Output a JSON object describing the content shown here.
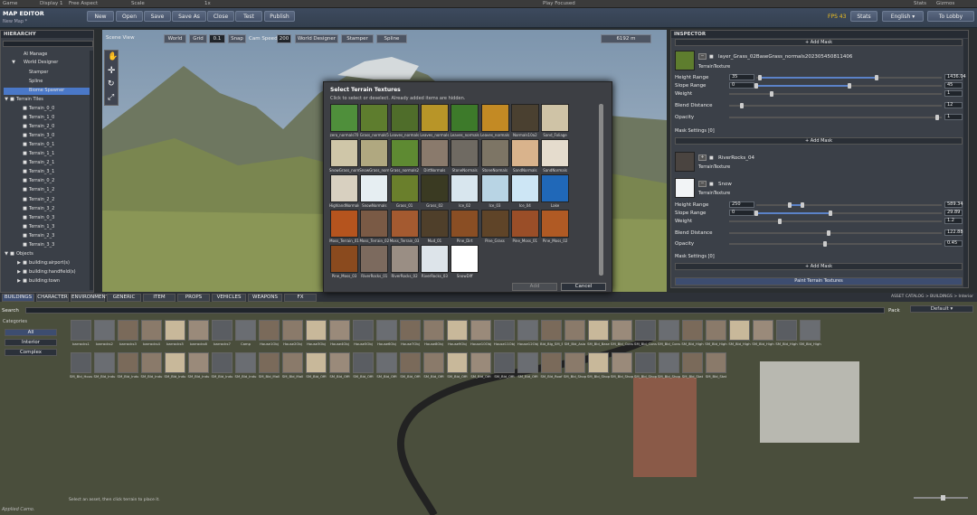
{
  "unity": {
    "game": "Game",
    "display": "Display 1",
    "aspect": "Free Aspect",
    "scale_label": "Scale",
    "scale_val": "1x",
    "play_focused": "Play Focused",
    "stats": "Stats",
    "gizmos": "Gizmos"
  },
  "topbar": {
    "title": "MAP EDITOR",
    "subtitle": "New Map *",
    "buttons": [
      "New",
      "Open",
      "Save",
      "Save As",
      "Close",
      "Test",
      "Publish"
    ],
    "fps": "FPS 43",
    "stats": "Stats",
    "language": "English",
    "to_lobby": "To Lobby"
  },
  "hierarchy": {
    "title": "HIERARCHY",
    "items": [
      "AI Manage",
      "World Designer",
      "Stamper",
      "Spline",
      "Biome Spawner",
      "Terrain Tiles",
      "Terrain_0_0",
      "Terrain_1_0",
      "Terrain_2_0",
      "Terrain_3_0",
      "Terrain_0_1",
      "Terrain_1_1",
      "Terrain_2_1",
      "Terrain_3_1",
      "Terrain_0_2",
      "Terrain_1_2",
      "Terrain_2_2",
      "Terrain_3_2",
      "Terrain_0_3",
      "Terrain_1_3",
      "Terrain_2_3",
      "Terrain_3_3",
      "Objects",
      "building:airport(s)",
      "building:handfield(s)",
      "building:town"
    ]
  },
  "scene": {
    "label": "Scene View",
    "buttons": [
      "World",
      "Grid",
      "0.1",
      "Snap"
    ],
    "cam_speed_label": "Cam Speed",
    "cam_speed": "200",
    "designer_buttons": [
      "World Designer",
      "Stamper",
      "Spline"
    ],
    "distance": "6192 m"
  },
  "dialog": {
    "title": "Select Terrain Textures",
    "subtitle": "Click to select or deselect. Already added items are hidden.",
    "add": "Add",
    "cancel": "Cancel",
    "tiles": [
      {
        "label": "zero_normals70",
        "color": "#4f8f3b"
      },
      {
        "label": "Grass_normals5",
        "color": "#5e7d2e"
      },
      {
        "label": "Leaves_normals",
        "color": "#4f6d2a"
      },
      {
        "label": "Leaves_normals",
        "color": "#b89528"
      },
      {
        "label": "Leaves_normals",
        "color": "#3d7a2a"
      },
      {
        "label": "Leaves_normals",
        "color": "#c38a24"
      },
      {
        "label": "Normals10a2",
        "color": "#4a4030"
      },
      {
        "label": "Sand_Foliage",
        "color": "#cfc3a6"
      },
      {
        "label": "SnowGrass_norm",
        "color": "#cfc6a8"
      },
      {
        "label": "SnowGrass_norm",
        "color": "#b0a880"
      },
      {
        "label": "Grass_normals2",
        "color": "#5e8a32"
      },
      {
        "label": "DirtNormals",
        "color": "#8a7a6c"
      },
      {
        "label": "StoneNormals",
        "color": "#6f6a62"
      },
      {
        "label": "StoneNormals",
        "color": "#7d7565"
      },
      {
        "label": "SandNormals",
        "color": "#d9b38c"
      },
      {
        "label": "SandNormals",
        "color": "#e5dccd"
      },
      {
        "label": "HighlandNormals",
        "color": "#d8d0c0"
      },
      {
        "label": "SnowNormals",
        "color": "#e6eef2"
      },
      {
        "label": "Grass_01",
        "color": "#6a7f2c"
      },
      {
        "label": "Grass_02",
        "color": "#3a3a22"
      },
      {
        "label": "Ice_02",
        "color": "#d8e6ee"
      },
      {
        "label": "Ice_03",
        "color": "#b8d4e4"
      },
      {
        "label": "Ice_04",
        "color": "#cde6f5"
      },
      {
        "label": "Lake",
        "color": "#2068b8"
      },
      {
        "label": "Moss_Terrain_01",
        "color": "#b5541e"
      },
      {
        "label": "Moss_Terrain_02",
        "color": "#7a5a45"
      },
      {
        "label": "Moss_Terrain_03",
        "color": "#a45a30"
      },
      {
        "label": "Mud_01",
        "color": "#4f3f2a"
      },
      {
        "label": "Pine_Dirt",
        "color": "#8a4e24"
      },
      {
        "label": "Pine_Grass",
        "color": "#5f4428"
      },
      {
        "label": "Pine_Moss_01",
        "color": "#9a4e28"
      },
      {
        "label": "Pine_Moss_02",
        "color": "#b05a24"
      },
      {
        "label": "Pine_Moss_03",
        "color": "#8a4a1e"
      },
      {
        "label": "RiverRocks_01",
        "color": "#7c6a5e"
      },
      {
        "label": "RiverRocks_02",
        "color": "#9a8e84"
      },
      {
        "label": "RiverRocks_03",
        "color": "#dde4ea"
      },
      {
        "label": "SnowDiff",
        "color": "#ffffff"
      }
    ]
  },
  "inspector": {
    "title": "INSPECTOR",
    "add_mask_top": "+ Add Mask",
    "layer1": {
      "name": "layer_Grass_02BaseGrass_normals202305450811406",
      "type": "TerrainTexture",
      "height_range_label": "Height Range",
      "height_min": "35",
      "height_max": "1436.04",
      "slope_range_label": "Slope Range",
      "slope_min": "0",
      "slope_max": "45",
      "weight_label": "Weight",
      "weight": "1",
      "blend_label": "Blend Distance",
      "blend": "12",
      "opacity_label": "Opacity",
      "opacity": "1",
      "mask_settings": "Mask Settings [0]",
      "add_mask": "+ Add Mask",
      "height_frac": [
        0.02,
        0.65
      ],
      "slope_frac": [
        0.0,
        0.5
      ],
      "weight_frac": 0.2,
      "blend_frac": 0.06,
      "opacity_frac": 0.98
    },
    "layer2": {
      "name": "RiverRocks_04",
      "type": "TerrainTexture"
    },
    "layer3": {
      "name": "Snow",
      "type": "TerrainTexture",
      "height_range_label": "Height Range",
      "height_min": "250",
      "height_max": "589.34",
      "slope_range_label": "Slope Range",
      "slope_min": "0",
      "slope_max": "29.89",
      "weight_label": "Weight",
      "weight": "1.2",
      "blend_label": "Blend Distance",
      "blend": "122.88",
      "opacity_label": "Opacity",
      "opacity": "0.45",
      "mask_settings": "Mask Settings [0]",
      "add_mask": "+ Add Mask",
      "height_frac": [
        0.18,
        0.25
      ],
      "slope_frac": [
        0.0,
        0.4
      ],
      "weight_frac": 0.24,
      "blend_frac": 0.47,
      "opacity_frac": 0.45
    },
    "paint_button": "Paint Terrain Textures"
  },
  "tabs": [
    "BUILDINGS",
    "CHARACTER",
    "ENVIRONMENT",
    "GENERIC",
    "ITEM",
    "PROPS",
    "VEHICLES",
    "WEAPONS",
    "FX"
  ],
  "catalog": {
    "breadcrumb": "ASSET CATALOG > BUILDINGS > Interior",
    "search_label": "Search",
    "pack_label": "Pack",
    "pack_value": "Default",
    "categories_label": "Categories",
    "categories": [
      "All",
      "Interior",
      "Complex"
    ],
    "row1": [
      "barracks1",
      "barracks2",
      "barracks3",
      "barracks4",
      "barracks5",
      "barracks6",
      "barracks7",
      "Camp",
      "House1Obj",
      "House2Obj",
      "House3Obj",
      "House4Obj",
      "House5Obj",
      "House6Obj",
      "House7Obj",
      "House8Obj",
      "House9Obj",
      "House10Obj",
      "House11Obj",
      "House12Obj",
      "Bld_Blg_SM_Bld_Asia",
      "SM_Bld_Asia",
      "SM_Bld_Base",
      "SM_Bld_Cons",
      "SM_Bld_Cons",
      "SM_Bld_Cons",
      "SM_Bld_High",
      "SM_Bld_High",
      "SM_Bld_High",
      "SM_Bld_High",
      "SM_Bld_High",
      "SM_Bld_High"
    ],
    "row2": [
      "SM_Bld_Hous",
      "SM_Bld_Indu",
      "SM_Bld_Indu",
      "SM_Bld_Indu",
      "SM_Bld_Indu",
      "SM_Bld_Indu",
      "SM_Bld_Indu",
      "SM_Bld_Indu",
      "SM_Bld_Mall",
      "SM_Bld_Mall",
      "SM_Bld_Offi",
      "SM_Bld_Offi",
      "SM_Bld_Offi",
      "SM_Bld_Offi",
      "SM_Bld_Offi",
      "SM_Bld_Offi",
      "SM_Bld_Offi",
      "SM_Bld_Offi",
      "SM_Bld_Offi",
      "SM_Bld_Offi",
      "SM_Bld_Roof",
      "SM_Bld_Shop",
      "SM_Bld_Shop",
      "SM_Bld_Shop",
      "SM_Bld_Shop",
      "SM_Bld_Shop",
      "SM_Bld_Stat",
      "SM_Bld_Stat"
    ],
    "footer": "Select an asset, then click terrain to place it."
  },
  "status": "Applied Camo."
}
